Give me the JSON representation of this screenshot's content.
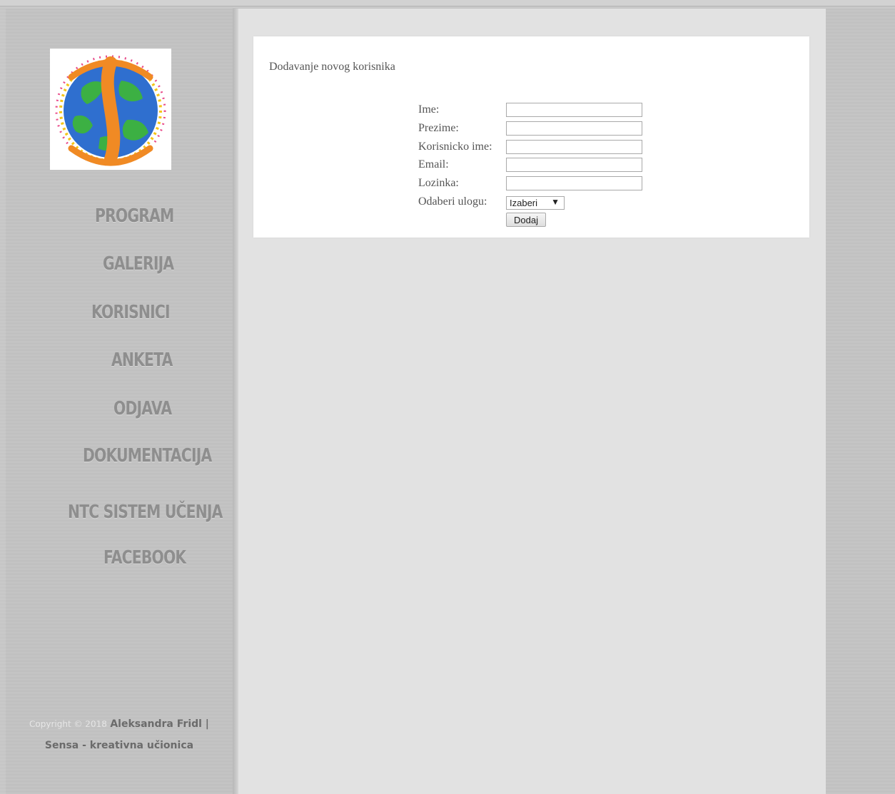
{
  "sidebar": {
    "nav": [
      {
        "label": "PROGRAM"
      },
      {
        "label": "GALERIJA"
      },
      {
        "label": "KORISNICI"
      },
      {
        "label": "ANKETA"
      },
      {
        "label": "ODJAVA"
      },
      {
        "label": "DOKUMENTACIJA"
      },
      {
        "label": "NTC SISTEM UČENJA"
      },
      {
        "label": "FACEBOOK"
      }
    ],
    "footer": {
      "copyright": "Copyright © 2018",
      "author": "Aleksandra Fridl |",
      "site": "Sensa - kreativna učionica"
    }
  },
  "form": {
    "title": "Dodavanje novog korisnika",
    "fields": [
      {
        "label": "Ime:",
        "value": ""
      },
      {
        "label": "Prezime:",
        "value": ""
      },
      {
        "label": "Korisnicko ime:",
        "value": ""
      },
      {
        "label": "Email:",
        "value": ""
      },
      {
        "label": "Lozinka:",
        "value": ""
      }
    ],
    "role": {
      "label": "Odaberi ulogu:",
      "selected": "Izaberi"
    },
    "submit_label": "Dodaj"
  },
  "icons": {
    "select_arrow": "▼"
  },
  "colors": {
    "logo_orange": "#f08a24",
    "brain_blue": "#2f6fcf",
    "brain_green": "#3cb043"
  }
}
